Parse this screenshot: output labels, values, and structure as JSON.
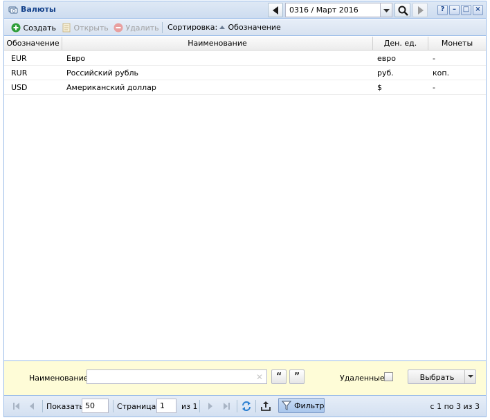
{
  "window": {
    "title": "Валюты",
    "period": {
      "value": "0316 / Март 2016"
    },
    "tools": {
      "help": "?",
      "minimize": "–",
      "maximize": "□",
      "close": "×"
    }
  },
  "toolbar": {
    "create": "Создать",
    "open": "Открыть",
    "delete": "Удалить",
    "sort_label": "Сортировка:",
    "sort_field": "Обозначение"
  },
  "grid": {
    "columns": [
      "Обозначение",
      "Наименование",
      "Ден. ед.",
      "Монеты"
    ],
    "rows": [
      {
        "code": "EUR",
        "name": "Евро",
        "unit": "евро",
        "coins": "-"
      },
      {
        "code": "RUR",
        "name": "Российский рубль",
        "unit": "руб.",
        "coins": "коп."
      },
      {
        "code": "USD",
        "name": "Американский доллар",
        "unit": "$",
        "coins": "-"
      }
    ]
  },
  "filter": {
    "name_label": "Наименование:",
    "name_value": "",
    "deleted_label": "Удаленные:",
    "deleted_checked": false,
    "select_label": "Выбрать"
  },
  "paging": {
    "show_label": "Показать",
    "page_size": "50",
    "page_label": "Страница",
    "page_value": "1",
    "of_pages": "из 1",
    "filter_label": "Фильтр",
    "summary": "с 1 по 3 из 3"
  }
}
